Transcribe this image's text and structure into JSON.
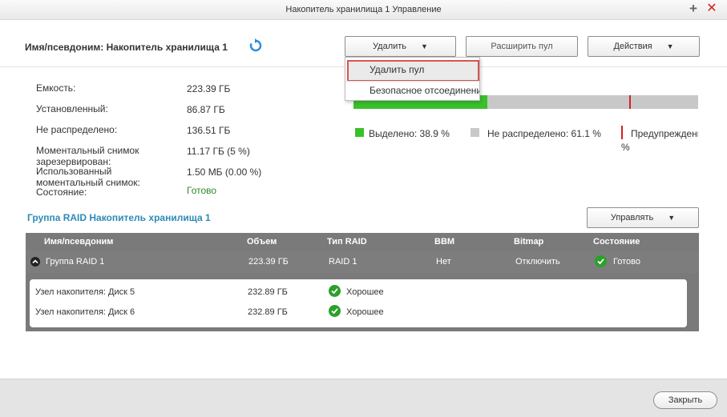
{
  "window": {
    "title": "Накопитель хранилища 1 Управление"
  },
  "header": {
    "alias_label": "Имя/псевдоним: Накопитель хранилища 1",
    "delete_label": "Удалить",
    "expand_label": "Расширить пул",
    "actions_label": "Действия"
  },
  "delete_menu": {
    "items": [
      "Удалить пул",
      "Безопасное отсоединение"
    ]
  },
  "info": {
    "capacity": {
      "label": "Емкость:",
      "value": "223.39 ГБ"
    },
    "installed": {
      "label": "Установленный:",
      "value": "86.87 ГБ"
    },
    "unallocated": {
      "label": "Не распределено:",
      "value": "136.51 ГБ"
    },
    "snapshot_reserved": {
      "label_line1": "Моментальный снимок",
      "label_line2": "зарезервирован:",
      "value": "11.17 ГБ (5 %)"
    },
    "snapshot_used": {
      "label_line1": "Использованный",
      "label_line2": "моментальный снимок:",
      "value": "1.50 МБ (0.00 %)"
    },
    "status": {
      "label": "Состояние:",
      "value": "Готово"
    }
  },
  "usage": {
    "allocated_fraction": 0.389,
    "warning_fraction": 0.8,
    "legend_allocated": "Выделено: 38.9 %",
    "legend_unallocated": "Не распределено: 61.1 %",
    "legend_warning": "Предупреждение",
    "legend_warning_pct": "%",
    "colors": {
      "allocated": "#39c12a",
      "unallocated": "#c8c8c8",
      "warning": "#d62020"
    }
  },
  "raid": {
    "title": "Группа RAID Накопитель хранилища 1",
    "manage_label": "Управлять",
    "columns": [
      "Имя/псевдоним",
      "Объем",
      "Тип RAID",
      "BBM",
      "Bitmap",
      "Состояние"
    ],
    "group": {
      "name": "Группа RAID 1",
      "size": "223.39 ГБ",
      "type": "RAID 1",
      "bbm": "Нет",
      "bitmap": "Отключить",
      "status": "Готово"
    },
    "disks": [
      {
        "name": "Узел накопителя: Диск 5",
        "size": "232.89 ГБ",
        "status": "Хорошее"
      },
      {
        "name": "Узел накопителя: Диск 6",
        "size": "232.89 ГБ",
        "status": "Хорошее"
      }
    ]
  },
  "footer": {
    "close_label": "Закрыть"
  }
}
